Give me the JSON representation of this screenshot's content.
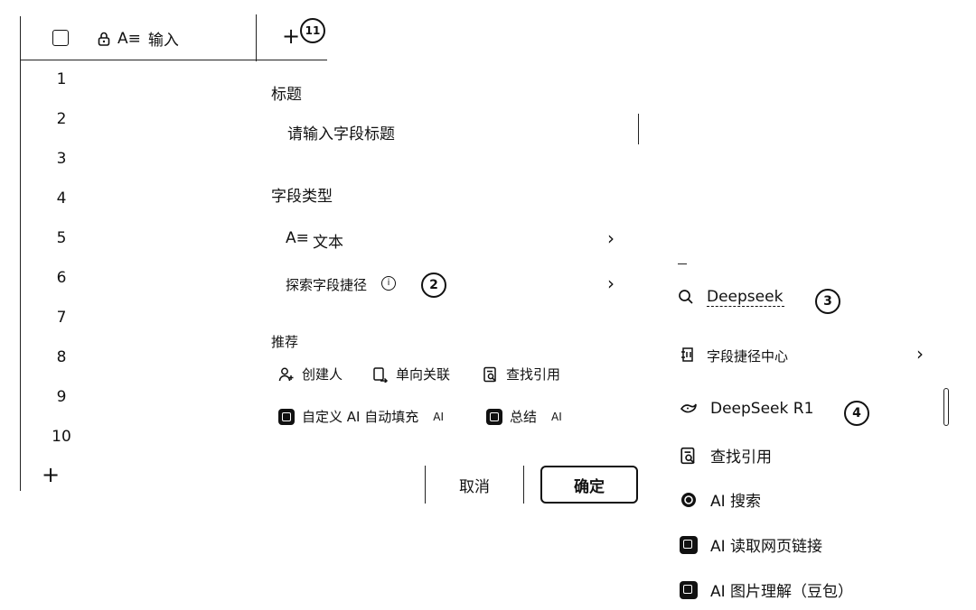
{
  "table": {
    "header_label": "输入",
    "header_type_glyph": "A≡",
    "rows": [
      "1",
      "2",
      "3",
      "4",
      "5",
      "6",
      "7",
      "8",
      "9",
      "10"
    ]
  },
  "markers": {
    "m1": "11",
    "m2": "2",
    "m3": "3",
    "m4": "4"
  },
  "form": {
    "title_label": "标题",
    "title_placeholder": "请输入字段标题",
    "field_type_label": "字段类型",
    "field_type_glyph": "A≡",
    "field_type_value": "文本",
    "explore_label": "探索字段捷径",
    "recommend_label": "推荐",
    "recommend_items": [
      {
        "label": "创建人"
      },
      {
        "label": "单向关联"
      },
      {
        "label": "查找引用"
      }
    ],
    "ai_items": [
      {
        "label": "自定义 AI 自动填充",
        "tag": "AI"
      },
      {
        "label": "总结",
        "tag": "AI"
      }
    ],
    "cancel_label": "取消",
    "confirm_label": "确定"
  },
  "search_panel": {
    "query": "Deepseek",
    "center_label": "字段捷径中心",
    "results": [
      {
        "label": "DeepSeek R1",
        "icon": "deepseek-whale-icon"
      },
      {
        "label": "查找引用",
        "icon": "lookup-icon"
      },
      {
        "label": "AI 搜索",
        "icon": "ai-search-icon"
      },
      {
        "label": "AI 读取网页链接",
        "icon": "web-link-icon"
      },
      {
        "label": "AI 图片理解（豆包）",
        "icon": "image-understanding-icon"
      }
    ]
  }
}
